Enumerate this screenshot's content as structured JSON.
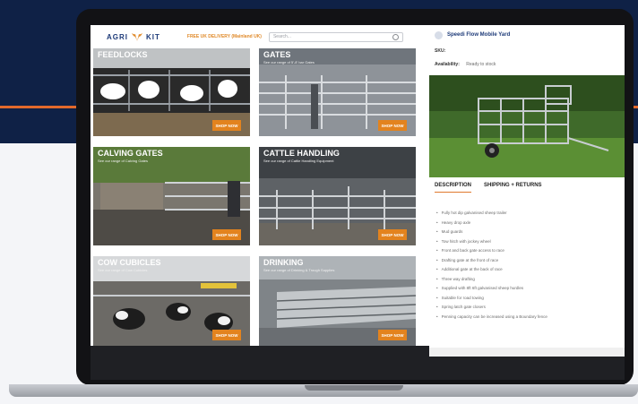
{
  "colors": {
    "navy": "#0f2146",
    "accent": "#e2692c",
    "brand_blue": "#1d3a78",
    "cta": "#e3831e"
  },
  "header": {
    "logo_left": "AGRI",
    "logo_right": "KIT",
    "promo": "FREE UK DELIVERY (Mainland UK)",
    "search_placeholder": "Search..."
  },
  "tiles": [
    {
      "title": "FEEDLOCKS",
      "subtitle": "",
      "cta": "SHOP NOW"
    },
    {
      "title": "GATES",
      "subtitle": "See our range of 5'-8' bar Gates",
      "cta": "SHOP NOW"
    },
    {
      "title": "CALVING GATES",
      "subtitle": "See our range of Calving Gates",
      "cta": "SHOP NOW"
    },
    {
      "title": "CATTLE HANDLING",
      "subtitle": "See our range of Cattle Handling Equipment",
      "cta": "SHOP NOW"
    },
    {
      "title": "COW CUBICLES",
      "subtitle": "See our range of Cow Cubicles",
      "cta": "SHOP NOW"
    },
    {
      "title": "DRINKING",
      "subtitle": "See our range of Drinking & Trough Supplies",
      "cta": "SHOP NOW"
    }
  ],
  "product": {
    "title": "Speedi Flow Mobile Yard",
    "sku_label": "SKU:",
    "availability_label": "Availability:",
    "availability_value": "Ready to stock",
    "tabs": [
      "DESCRIPTION",
      "SHIPPING + RETURNS"
    ],
    "features": [
      "Fully hot dip galvanised sheep trailer",
      "Heavy drop axle",
      "Mud guards",
      "Tow hitch with jockey wheel",
      "Front and back gate access to race",
      "Drafting gate at the front of race",
      "Additional gate at the back of race",
      "Three way drafting",
      "Supplied with 8ft 6ft galvanised sheep hurdles",
      "Suitable for road towing",
      "Spring latch gate closers",
      "Penning capacity can be increased using a Boundary fence"
    ]
  }
}
